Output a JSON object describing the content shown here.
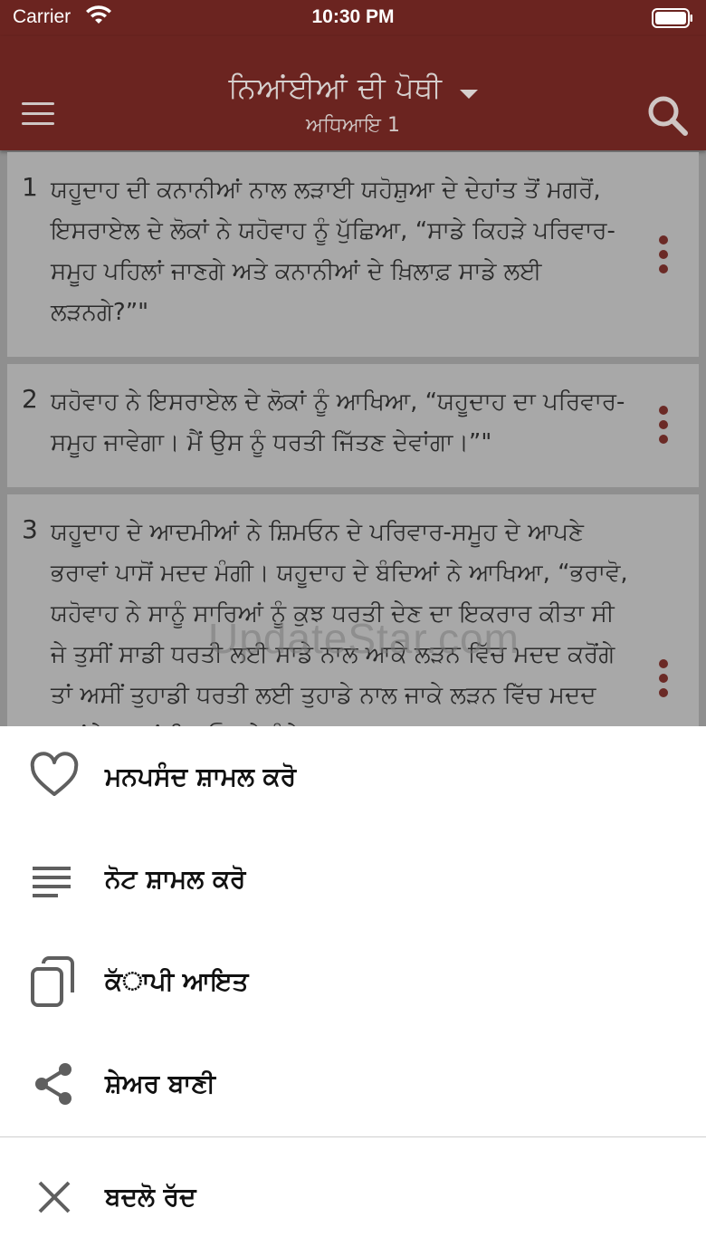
{
  "status_bar": {
    "carrier": "Carrier",
    "time": "10:30 PM"
  },
  "header": {
    "title": "ਨਿਆਂਈਆਂ ਦੀ ਪੋਥੀ",
    "subtitle": "ਅਧਿਆਇ 1",
    "menu_icon": "hamburger-icon",
    "search_icon": "search-icon",
    "bar_color": "#6b2420"
  },
  "verses": [
    {
      "number": "1",
      "text": "ਯਹੂਦਾਹ ਦੀ ਕਨਾਨੀਆਂ ਨਾਲ ਲੜਾਈ ਯਹੋਸ਼ੁਆ ਦੇ ਦੇਹਾਂਤ ਤੋਂ ਮਗਰੋਂ, ਇਸਰਾਏਲ ਦੇ ਲੋਕਾਂ ਨੇ ਯਹੋਵਾਹ ਨੂੰ ਪੁੱਛਿਆ, “ਸਾਡੇ ਕਿਹੜੇ ਪਰਿਵਾਰ-ਸਮੂਹ ਪਹਿਲਾਂ ਜਾਣਗੇ ਅਤੇ ਕਨਾਨੀਆਂ ਦੇ ਖ਼ਿਲਾਫ਼ ਸਾਡੇ ਲਈ ਲੜਨਗੇ?”\""
    },
    {
      "number": "2",
      "text": "ਯਹੋਵਾਹ ਨੇ ਇਸਰਾਏਲ ਦੇ ਲੋਕਾਂ ਨੂੰ ਆਖਿਆ, “ਯਹੂਦਾਹ ਦਾ ਪਰਿਵਾਰ-ਸਮੂਹ ਜਾਵੇਗਾ। ਮੈਂ ਉਸ ਨੂੰ ਧਰਤੀ ਜਿੱਤਣ ਦੇਵਾਂਗਾ।”\""
    },
    {
      "number": "3",
      "text": "ਯਹੂਦਾਹ ਦੇ ਆਦਮੀਆਂ ਨੇ ਸ਼ਿਮਓਨ ਦੇ ਪਰਿਵਾਰ-ਸਮੂਹ ਦੇ ਆਪਣੇ ਭਰਾਵਾਂ ਪਾਸੋਂ ਮਦਦ ਮੰਗੀ। ਯਹੂਦਾਹ ਦੇ ਬੰਦਿਆਂ ਨੇ ਆਖਿਆ, “ਭਰਾਵੋ, ਯਹੋਵਾਹ ਨੇ ਸਾਨੂੰ ਸਾਰਿਆਂ ਨੂੰ ਕੁਝ ਧਰਤੀ ਦੇਣ ਦਾ ਇਕਰਾਰ ਕੀਤਾ ਸੀ ਜੇ ਤੁਸੀਂ ਸਾਡੀ ਧਰਤੀ ਲਈ ਸਾਡੇ ਨਾਲ ਆਕੇ ਲੜਨ ਵਿੱਚ ਮਦਦ ਕਰੋਂਗੇ ਤਾਂ ਅਸੀਂ ਤੁਹਾਡੀ ਧਰਤੀ ਲਈ ਤੁਹਾਡੇ ਨਾਲ ਜਾਕੇ ਲੜਨ ਵਿੱਚ ਮਦਦ ਕਰਾਂਗੇ।” ਤਾਂ ਸ਼ਿਮਓਨ ਦੇ ਬੰਦੇ"
    }
  ],
  "watermark": "UpdateStar.com",
  "action_sheet": {
    "items": [
      {
        "icon": "heart-icon",
        "label": "ਮਨਪਸੰਦ ਸ਼ਾਮਲ ਕਰੋ"
      },
      {
        "icon": "notes-icon",
        "label": "ਨੋਟ ਸ਼ਾਮਲ ਕਰੋ"
      },
      {
        "icon": "copy-icon",
        "label": "ਕੱਾਪੀ ਆਇਤ"
      },
      {
        "icon": "share-icon",
        "label": "ਸ਼ੇਅਰ ਬਾਣੀ"
      }
    ],
    "cancel": {
      "icon": "close-icon",
      "label": "ਬਦਲੋ ਰੱਦ"
    }
  }
}
